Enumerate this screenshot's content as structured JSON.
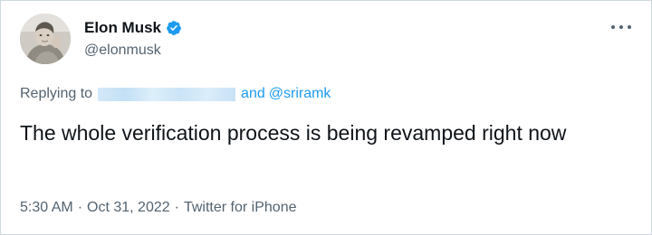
{
  "author": {
    "name": "Elon Musk",
    "handle": "@elonmusk",
    "verified_badge": "verified-badge-icon"
  },
  "menu": {
    "more_icon": "more-horizontal-icon"
  },
  "reply": {
    "label": "Replying to",
    "redacted_handle": "",
    "conjunction": "and",
    "mention": "@sriramk"
  },
  "tweet": {
    "text": "The whole verification process is being revamped right now"
  },
  "meta": {
    "time": "5:30 AM",
    "separator": "·",
    "date": "Oct 31, 2022",
    "source": "Twitter for iPhone"
  },
  "colors": {
    "link": "#1d9bf0",
    "secondary_text": "#536471",
    "primary_text": "#0f1419",
    "border": "#cfd9de"
  }
}
